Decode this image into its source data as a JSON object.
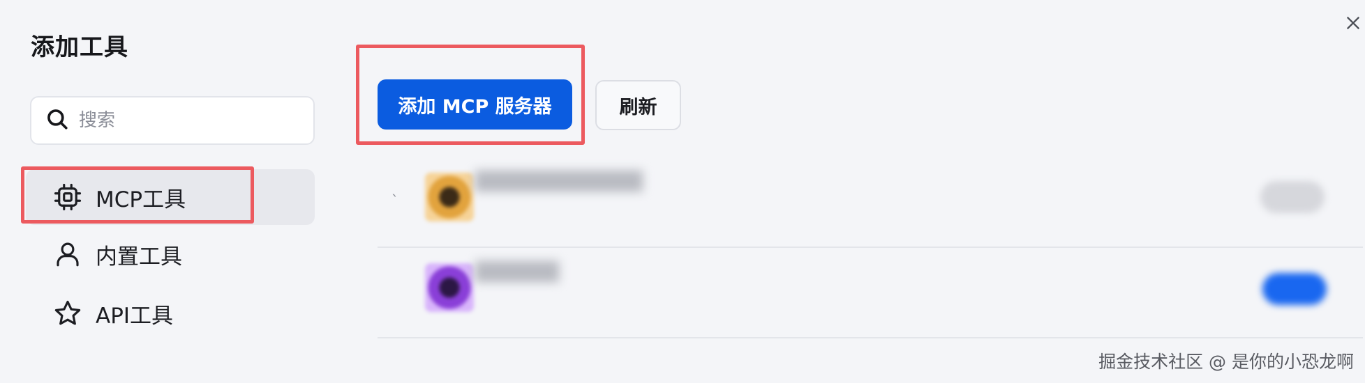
{
  "panel": {
    "title": "添加工具"
  },
  "search": {
    "placeholder": "搜索",
    "value": ""
  },
  "sidebar": {
    "items": [
      {
        "label": "MCP工具",
        "icon": "chip-icon",
        "active": true
      },
      {
        "label": "内置工具",
        "icon": "person-icon",
        "active": false
      },
      {
        "label": "API工具",
        "icon": "star-icon",
        "active": false
      }
    ]
  },
  "toolbar": {
    "add_label": "添加 MCP 服务器",
    "refresh_label": "刷新"
  },
  "servers": [
    {
      "name": "████████████",
      "description": "",
      "avatar_color": "#e2a33d",
      "enabled": false
    },
    {
      "name": "██████",
      "description": "",
      "avatar_color": "#8a3fd8",
      "enabled": true
    }
  ],
  "watermark": "掘金技术社区 @ 是你的小恐龙啊",
  "colors": {
    "primary": "#0b5ce0",
    "highlight": "#ec5a5f",
    "background": "#f4f5f8"
  }
}
